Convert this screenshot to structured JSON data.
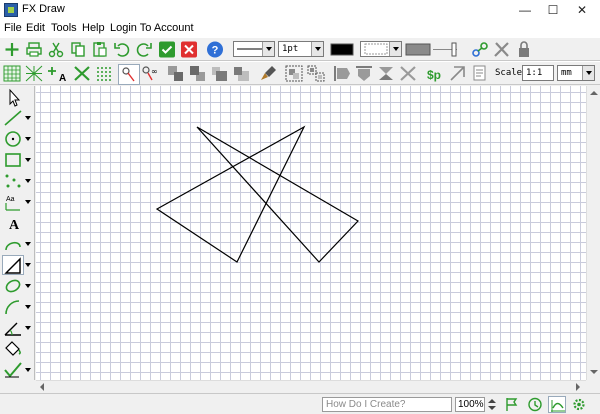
{
  "window": {
    "title": "FX Draw",
    "minimize": "—",
    "maximize": "☐",
    "close": "✕"
  },
  "menu": [
    "File",
    "Edit",
    "Tools",
    "Help",
    "Login To Account"
  ],
  "toolbar": {
    "line_width": "1pt",
    "scale_label": "Scale",
    "scale_value": "1:1",
    "units": "mm"
  },
  "status": {
    "how_do_placeholder": "How Do I Create?",
    "zoom": "100%"
  },
  "colors": {
    "accent_green": "#2e9b2e",
    "red": "#e03030",
    "blue": "#2f6fd6",
    "grid": "#c9cbdc"
  },
  "drawing": {
    "shape": "two overlapping triangles"
  }
}
